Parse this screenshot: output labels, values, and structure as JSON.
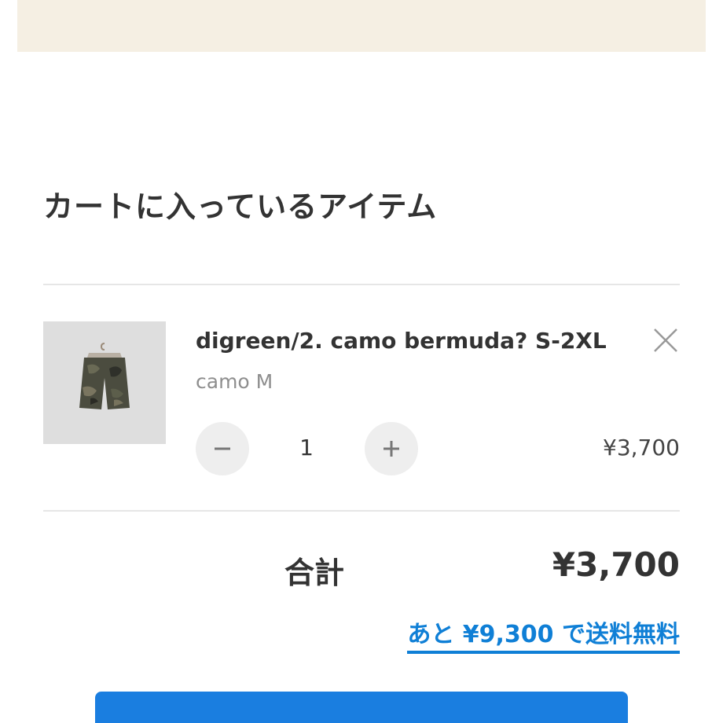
{
  "cart": {
    "heading": "カートに入っているアイテム",
    "items": [
      {
        "name": "digreen/2. camo bermuda? S-2XL",
        "variant": "camo M",
        "quantity": "1",
        "price": "¥3,700"
      }
    ],
    "total_label": "合計",
    "total_value": "¥3,700",
    "free_shipping_note": "あと ¥9,300 で送料無料"
  },
  "icons": {
    "remove": "close-icon",
    "decrease": "minus-icon",
    "increase": "plus-icon"
  },
  "colors": {
    "banner": "#f5efe3",
    "accent_blue": "#0f7fd6",
    "checkout_button": "#1a7ee0",
    "qty_button": "#eeeeee"
  }
}
